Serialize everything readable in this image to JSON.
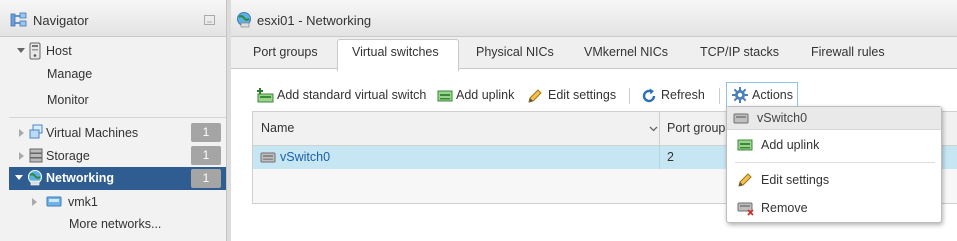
{
  "navigator": {
    "title": "Navigator",
    "host": {
      "label": "Host",
      "children": [
        "Manage",
        "Monitor"
      ]
    },
    "items": [
      {
        "label": "Virtual Machines",
        "badge": "1"
      },
      {
        "label": "Storage",
        "badge": "1"
      },
      {
        "label": "Networking",
        "badge": "1"
      }
    ],
    "networking_children": {
      "vmk": "vmk1",
      "more": "More networks..."
    }
  },
  "main": {
    "title": "esxi01 - Networking",
    "tabs": [
      "Port groups",
      "Virtual switches",
      "Physical NICs",
      "VMkernel NICs",
      "TCP/IP stacks",
      "Firewall rules"
    ],
    "active_tab": "Virtual switches",
    "toolbar": {
      "add_vswitch": "Add standard virtual switch",
      "add_uplink": "Add uplink",
      "edit_settings": "Edit settings",
      "refresh": "Refresh",
      "actions": "Actions"
    },
    "grid": {
      "columns": [
        "Name",
        "Port groups"
      ],
      "rows": [
        {
          "name": "vSwitch0",
          "port_groups": "2"
        }
      ]
    },
    "actions_menu": {
      "header": "vSwitch0",
      "items": [
        "Add uplink",
        "Edit settings",
        "Remove"
      ]
    }
  },
  "colors": {
    "nav_selected": "#2f5d92",
    "row_selected": "#c7e6f4",
    "link_blue": "#1a5fa8",
    "badge": "#a5a5a5"
  }
}
